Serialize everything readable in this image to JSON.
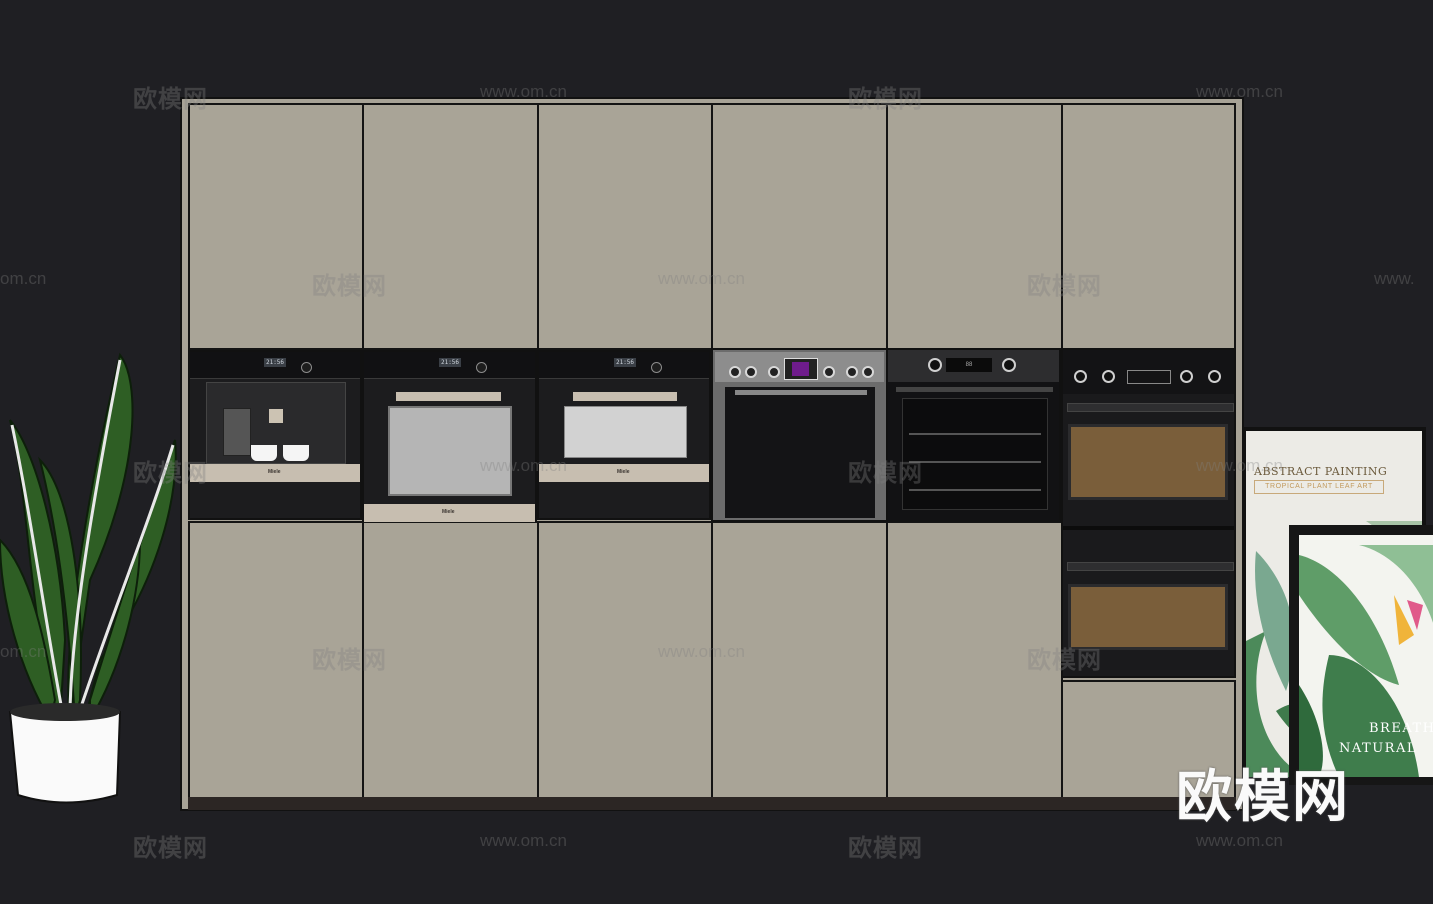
{
  "watermarks": {
    "brand": "欧模网",
    "url": "www.om.cn",
    "url_partial_left": "om.cn",
    "url_partial_right": "www.",
    "brand_large": "欧模网"
  },
  "appliances": {
    "miele_label": "Miele",
    "display_time": "21:56",
    "bosch_display": "88"
  },
  "posters": {
    "poster1_title": "ABSTRACT PAINTING",
    "poster1_subtitle": "TROPICAL PLANT LEAF ART",
    "poster2_line1": "BREATH",
    "poster2_line2": "NATURAL"
  },
  "colors": {
    "background": "#1f1f23",
    "cabinet": "#a9a497",
    "appliance_black": "#1c1c1e",
    "bosch_purple": "#6f1c8c"
  }
}
